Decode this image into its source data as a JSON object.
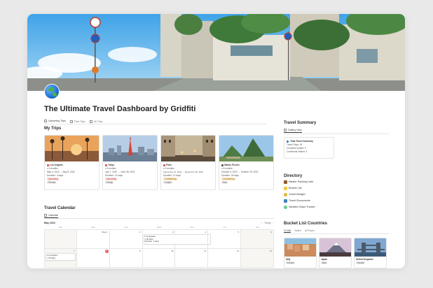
{
  "page": {
    "title": "The Ultimate Travel Dashboard by Gridfiti",
    "tabs": [
      "Upcoming Trips",
      "Past Trips",
      "All Trips"
    ]
  },
  "my_trips": {
    "heading": "My Trips",
    "cards": [
      {
        "name": "Los Angeles",
        "duration_label": "≤ 6 months",
        "dates": "May 4, 2022 → May 8, 2022",
        "duration": "Duration: 4 days",
        "status": "Upcoming",
        "group": "Friends"
      },
      {
        "name": "Tokyo",
        "duration_label": "≤ 6 months",
        "dates": "July 7, 2022 → June 28, 2022",
        "duration": "Duration: 21 days",
        "status": "Upcoming",
        "group": "Family"
      },
      {
        "name": "Paris",
        "duration_label": "≤ 6 months",
        "dates": "September 16, 2022 → September 28, 2022",
        "duration": "Duration: 12 days",
        "status": "Considering",
        "group": "Couple"
      },
      {
        "name": "Machu Picchu",
        "duration_label": "≤ 6 months",
        "dates": "October 4, 2022 → October 29, 2022",
        "duration": "Duration: 25 days",
        "status": "Considering",
        "group": "Solo"
      }
    ]
  },
  "travel_calendar": {
    "heading": "Travel Calendar",
    "view": "Calendar",
    "month": "May 2022",
    "today_label": "Today",
    "days_of_week": [
      "Sun",
      "Mon",
      "Tue",
      "Wed",
      "Thu",
      "Fri",
      "Sat"
    ],
    "week1": [
      "",
      "May 1",
      "2",
      "3",
      "4",
      "5",
      "6"
    ],
    "week2": [
      "7",
      "8",
      "9",
      "10",
      "11",
      "12",
      "13"
    ],
    "events": [
      {
        "name": "Los Angeles",
        "detail": "≤ 28 days",
        "detail2": "Duration: 4 days"
      }
    ]
  },
  "travel_summary": {
    "heading": "Travel Summary",
    "view": "Gallery view",
    "card_title": "Total Travel Summary",
    "lines": [
      "Travel Days: 18",
      "Countries Visited: 3",
      "Continents Visited: 3"
    ]
  },
  "directory": {
    "heading": "Directory",
    "items": [
      "Master Packing Lists",
      "Bucket List",
      "Travel Budget",
      "Travel Documents",
      "Vacation Days Tracker"
    ]
  },
  "bucket_list": {
    "heading": "Bucket List Countries",
    "tabs": [
      "To Visit",
      "Visited",
      "All Places"
    ],
    "cards": [
      {
        "name": "Italy",
        "tag": "Europe"
      },
      {
        "name": "Japan",
        "tag": "Asia"
      },
      {
        "name": "United Kingdom",
        "tag": "Europe"
      }
    ]
  },
  "colors": {
    "accent_red": "#eb5757",
    "upcoming_tag": "#fbe4e4",
    "considering_tag": "#fdecc8"
  }
}
